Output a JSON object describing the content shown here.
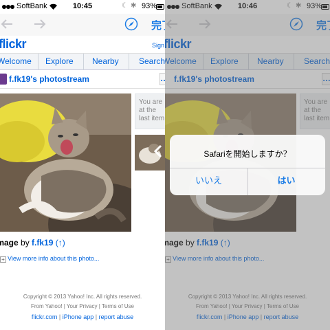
{
  "left": {
    "status": {
      "carrier": "SoftBank",
      "time": "10:45",
      "battery": "93%"
    },
    "done_label": "完了",
    "logo": "flickr",
    "signin": "Sign In",
    "tabs": [
      "Welcome",
      "Explore",
      "Nearby",
      "Search"
    ],
    "stream_title": "f.fk19's photostream",
    "side_note": "You are at the last item.",
    "caption_prefix": "Image",
    "caption_by": " by ",
    "caption_owner": "f.fk19",
    "caption_up": "(↑)",
    "more_info": "View more info about this photo...",
    "footer1": "Copyright © 2013 Yahoo! Inc. All rights reserved.",
    "footer2": "From Yahoo! | Your Privacy | Terms of Use",
    "footer3": [
      "flickr.com",
      "iPhone app",
      "report abuse"
    ]
  },
  "right": {
    "status": {
      "carrier": "SoftBank",
      "time": "10:46",
      "battery": "93%"
    },
    "done_label": "完了",
    "logo": "flickr",
    "tabs": [
      "Welcome",
      "Explore",
      "Nearby",
      "Search"
    ],
    "stream_title": "f.fk19's photostream",
    "side_note": "You are at the last item.",
    "caption_prefix": "Image",
    "caption_by": " by ",
    "caption_owner": "f.fk19",
    "caption_up": "(↑)",
    "more_info": "View more info about this photo...",
    "footer1": "Copyright © 2013 Yahoo! Inc. All rights reserved.",
    "footer2": "From Yahoo! | Your Privacy | Terms of Use",
    "footer3": [
      "flickr.com",
      "iPhone app",
      "report abuse"
    ],
    "alert": {
      "message": "Safariを開始しますか？",
      "cancel": "いいえ",
      "confirm": "はい"
    }
  },
  "colors": {
    "accent": "#0063dc",
    "ios_blue": "#1b7ce6"
  }
}
